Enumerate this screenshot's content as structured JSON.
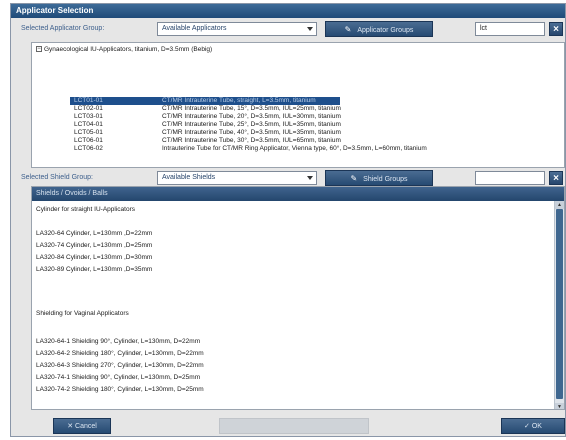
{
  "window": {
    "title": "Applicator Selection"
  },
  "applicator_row": {
    "label": "Selected Applicator Group:",
    "select_value": "Available Applicators",
    "button_label": "Applicator Groups",
    "search_value": "lct"
  },
  "tree": {
    "root_label": "Gynaecological IU-Applicators, titanium, D=3.5mm (Bebig)",
    "items": [
      {
        "code": "LCT01-01",
        "desc": "CT/MR Intrauterine Tube, straight, L=3.5mm, titanium",
        "selected": true
      },
      {
        "code": "LCT02-01",
        "desc": "CT/MR Intrauterine Tube, 15°, D=3.5mm, IUL=25mm, titanium"
      },
      {
        "code": "LCT03-01",
        "desc": "CT/MR Intrauterine Tube, 20°, D=3.5mm, IUL=30mm, titanium"
      },
      {
        "code": "LCT04-01",
        "desc": "CT/MR Intrauterine Tube, 25°, D=3.5mm, IUL=35mm, titanium"
      },
      {
        "code": "LCT05-01",
        "desc": "CT/MR Intrauterine Tube, 40°, D=3.5mm, IUL=35mm, titanium"
      },
      {
        "code": "LCT06-01",
        "desc": "CT/MR Intrauterine Tube, 30°, D=3.5mm, IUL=65mm, titanium"
      },
      {
        "code": "LCT06-02",
        "desc": "Intrauterine Tube for CT/MR Ring Applicator, Vienna type, 60°, D=3.5mm, L=60mm, titanium"
      }
    ]
  },
  "shield_row": {
    "label": "Selected Shield Group:",
    "select_value": "Available Shields",
    "button_label": "Shield Groups",
    "search_value": ""
  },
  "shield_list": {
    "header": "Shields / Ovoids / Balls",
    "items": [
      "Cylinder for straight IU-Applicators",
      "",
      "LA320-64 Cylinder, L=130mm ,D=22mm",
      "LA320-74 Cylinder, L=130mm ,D=25mm",
      "LA320-84 Cylinder, L=130mm ,D=30mm",
      "LA320-89 Cylinder, L=130mm ,D=35mm",
      "",
      "",
      "Shielding for Vaginal Applicators",
      "",
      "LA320-64-1 Shielding  90°, Cylinder, L=130mm, D=22mm",
      "LA320-64-2 Shielding  180°, Cylinder, L=130mm, D=22mm",
      "LA320-64-3 Shielding  270°, Cylinder, L=130mm, D=22mm",
      "LA320-74-1 Shielding  90°, Cylinder, L=130mm, D=25mm",
      "LA320-74-2 Shielding  180°, Cylinder, L=130mm, D=25mm"
    ]
  },
  "footer": {
    "cancel_label": "Cancel",
    "ok_label": "OK"
  }
}
